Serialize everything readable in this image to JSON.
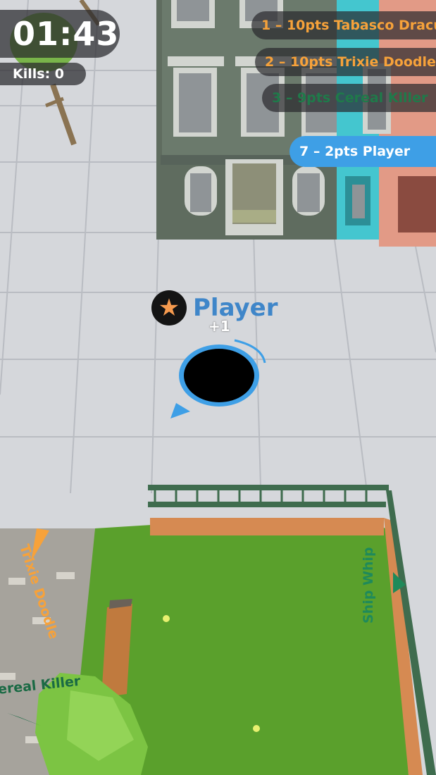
{
  "hud": {
    "timer": "01:43",
    "kills": "Kills: 0"
  },
  "leaderboard": [
    {
      "text": "1 – 10pts Tabasco Dracu",
      "color": "#f7a23a"
    },
    {
      "text": "2 – 10pts Trixie Doodle",
      "color": "#f7a23a"
    },
    {
      "text": "3 – 9pts Cereal Killer",
      "color": "#1f7a4a"
    },
    {
      "text": "7 – 2pts Player",
      "color": "#ffffff",
      "highlight": "#3e9fe6"
    }
  ],
  "player": {
    "name": "Player",
    "score_popup": "+1",
    "icon": "star-icon",
    "accent": "#3e9fe6"
  },
  "world_labels": {
    "trixie": "Trixie Doodle",
    "ship": "Ship Whip",
    "cereal": "ereal Killer"
  },
  "colors": {
    "ground": "#d6d8dc",
    "grass": "#5aa02c",
    "building": "#6b7a6c",
    "hole_ring": "#3e9fe6"
  }
}
